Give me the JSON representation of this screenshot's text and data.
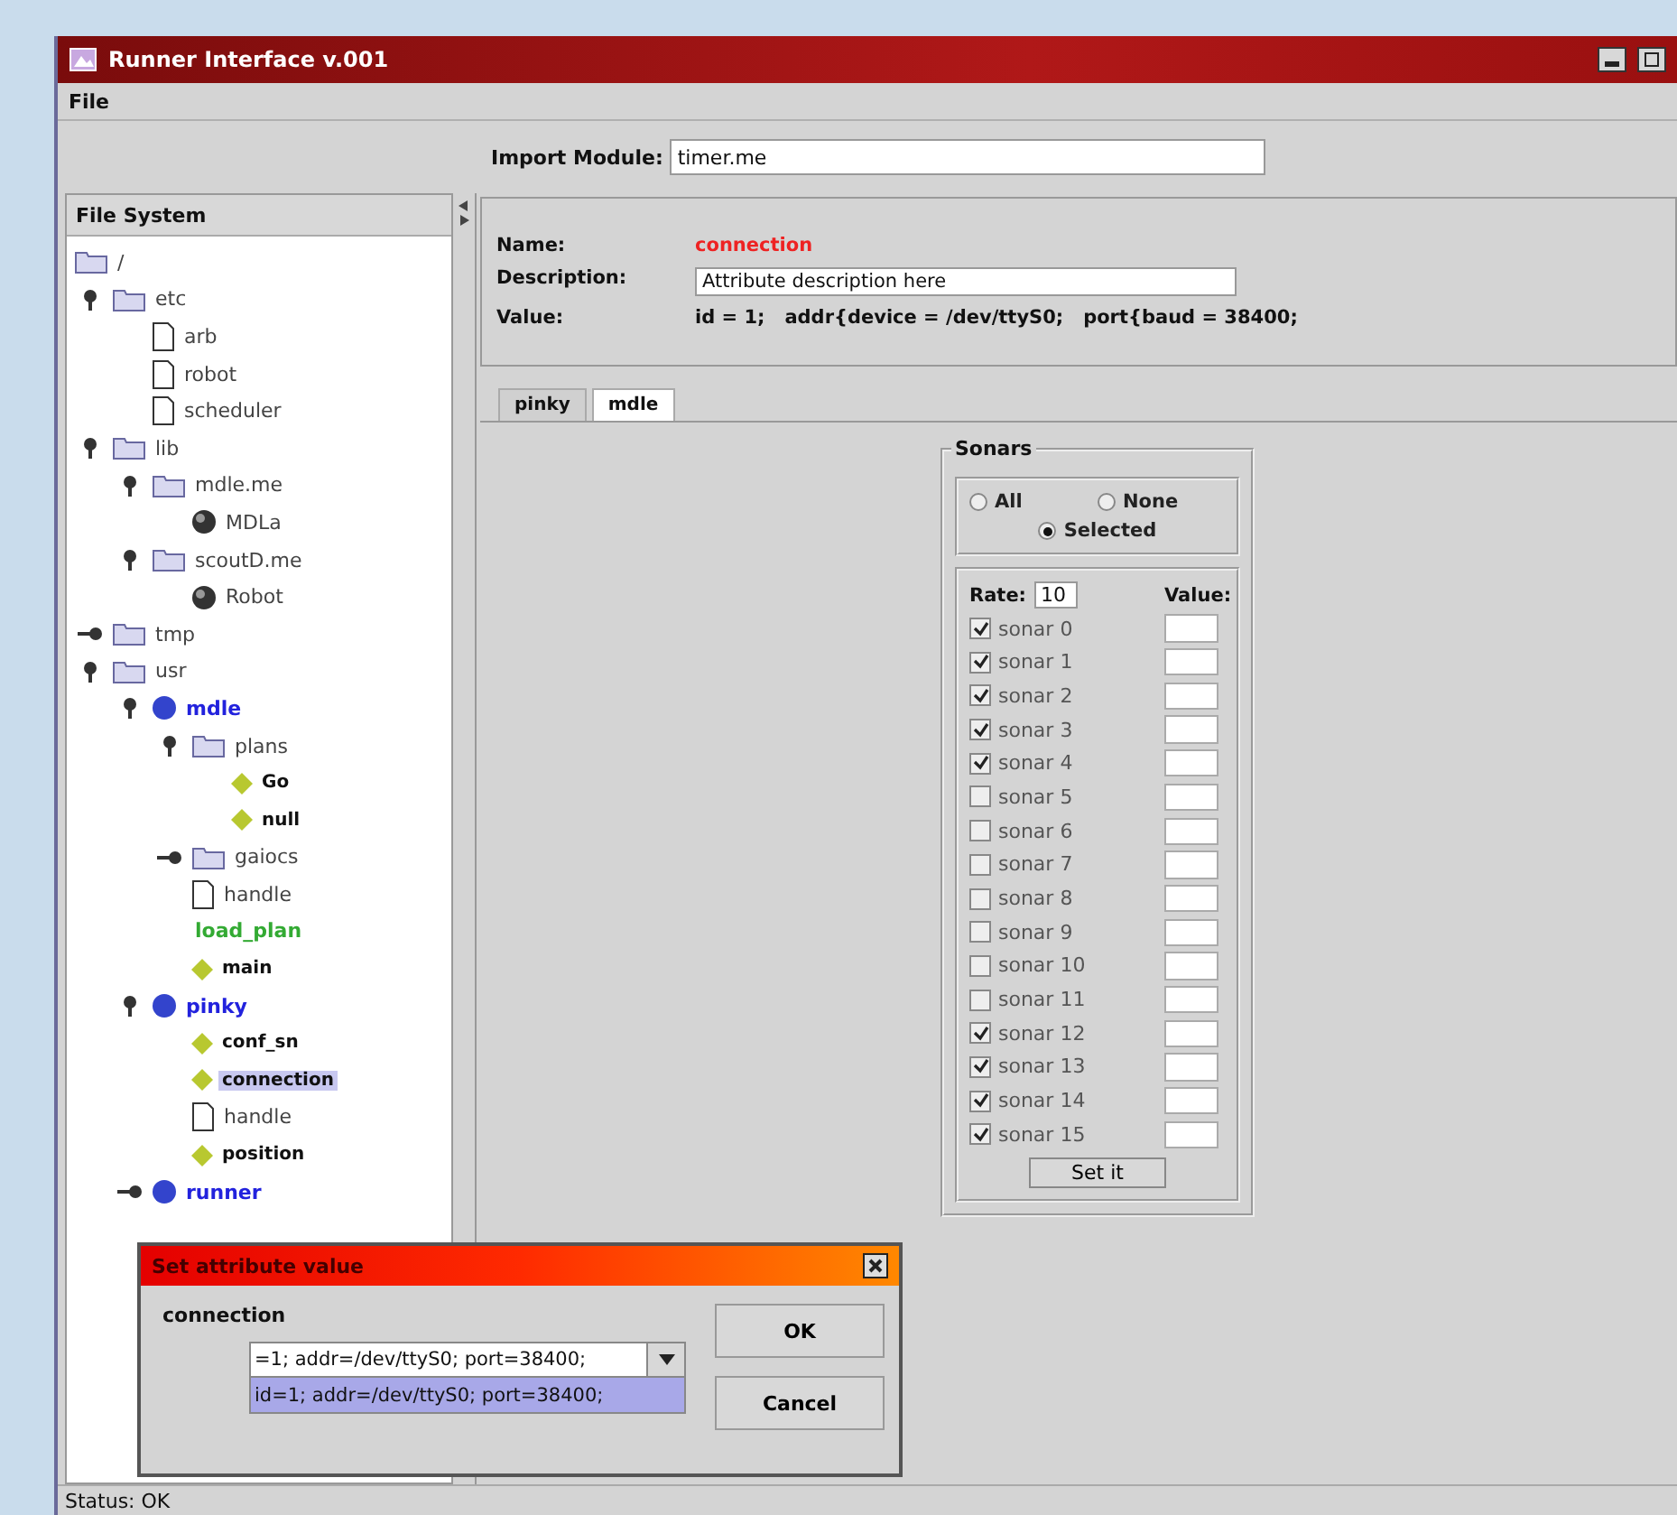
{
  "window": {
    "title": "Runner Interface v.001"
  },
  "menu": [
    "File"
  ],
  "import_module": {
    "label": "Import Module:",
    "value": "timer.me"
  },
  "file_system": {
    "title": "File System",
    "tree": [
      {
        "label": "/",
        "kind": "folder",
        "selected": false,
        "children": [
          {
            "label": "etc",
            "kind": "folder",
            "selected": false,
            "expanded": true,
            "children": [
              {
                "label": "arb",
                "kind": "file",
                "selected": false
              },
              {
                "label": "robot",
                "kind": "file",
                "selected": false
              },
              {
                "label": "scheduler",
                "kind": "file",
                "selected": false
              }
            ]
          },
          {
            "label": "lib",
            "kind": "folder",
            "selected": false,
            "expanded": true,
            "children": [
              {
                "label": "mdle.me",
                "kind": "folder",
                "selected": false,
                "expanded": true,
                "children": [
                  {
                    "label": "MDLa",
                    "kind": "object",
                    "selected": false
                  }
                ]
              },
              {
                "label": "scoutD.me",
                "kind": "folder",
                "selected": false,
                "expanded": true,
                "children": [
                  {
                    "label": "Robot",
                    "kind": "object",
                    "selected": false
                  }
                ]
              }
            ]
          },
          {
            "label": "tmp",
            "kind": "folder",
            "selected": false,
            "expanded": false
          },
          {
            "label": "usr",
            "kind": "folder",
            "selected": false,
            "expanded": true,
            "children": [
              {
                "label": "mdle",
                "kind": "module",
                "selected": false,
                "expanded": true,
                "children": [
                  {
                    "label": "plans",
                    "kind": "folder",
                    "selected": false,
                    "expanded": true,
                    "children": [
                      {
                        "label": "Go",
                        "kind": "plan",
                        "selected": false
                      },
                      {
                        "label": "null",
                        "kind": "plan",
                        "selected": false
                      }
                    ]
                  },
                  {
                    "label": "gaiocs",
                    "kind": "folder",
                    "selected": false,
                    "expanded": false
                  },
                  {
                    "label": "handle",
                    "kind": "file",
                    "selected": false
                  },
                  {
                    "label": "load_plan",
                    "kind": "label",
                    "selected": false
                  },
                  {
                    "label": "main",
                    "kind": "plan",
                    "selected": false
                  }
                ]
              },
              {
                "label": "pinky",
                "kind": "module",
                "selected": false,
                "expanded": true,
                "children": [
                  {
                    "label": "conf_sn",
                    "kind": "plan",
                    "selected": false
                  },
                  {
                    "label": "connection",
                    "kind": "plan",
                    "selected": true
                  },
                  {
                    "label": "handle",
                    "kind": "file",
                    "selected": false
                  },
                  {
                    "label": "position",
                    "kind": "plan",
                    "selected": false
                  }
                ]
              },
              {
                "label": "runner",
                "kind": "module",
                "selected": false,
                "expanded": false
              }
            ]
          }
        ]
      }
    ]
  },
  "attribute": {
    "name_label": "Name:",
    "name": "connection",
    "description_label": "Description:",
    "description": "Attribute description here",
    "value_label": "Value:",
    "value": "id = 1;   addr{device = /dev/ttyS0;   port{baud = 38400;"
  },
  "tabs": [
    {
      "label": "pinky",
      "selected": false
    },
    {
      "label": "mdle",
      "selected": true
    }
  ],
  "sonars": {
    "title": "Sonars",
    "modes": [
      {
        "label": "All",
        "selected": false
      },
      {
        "label": "None",
        "selected": false
      },
      {
        "label": "Selected",
        "selected": true
      }
    ],
    "rate_label": "Rate:",
    "rate": "10",
    "value_label": "Value:",
    "items": [
      {
        "label": "sonar 0",
        "checked": true
      },
      {
        "label": "sonar 1",
        "checked": true
      },
      {
        "label": "sonar 2",
        "checked": true
      },
      {
        "label": "sonar 3",
        "checked": true
      },
      {
        "label": "sonar 4",
        "checked": true
      },
      {
        "label": "sonar 5",
        "checked": false
      },
      {
        "label": "sonar 6",
        "checked": false
      },
      {
        "label": "sonar 7",
        "checked": false
      },
      {
        "label": "sonar 8",
        "checked": false
      },
      {
        "label": "sonar 9",
        "checked": false
      },
      {
        "label": "sonar 10",
        "checked": false
      },
      {
        "label": "sonar 11",
        "checked": false
      },
      {
        "label": "sonar 12",
        "checked": true
      },
      {
        "label": "sonar 13",
        "checked": true
      },
      {
        "label": "sonar 14",
        "checked": true
      },
      {
        "label": "sonar 15",
        "checked": true
      }
    ],
    "button": "Set it"
  },
  "dialog": {
    "title": "Set attribute value",
    "label": "connection",
    "combo_value": "=1; addr=/dev/ttyS0; port=38400;",
    "options": [
      {
        "label": "id=1; addr=/dev/ttyS0; port=38400;",
        "selected": true
      }
    ],
    "buttons": [
      "OK",
      "Cancel"
    ]
  },
  "status_bar": "Status: OK"
}
